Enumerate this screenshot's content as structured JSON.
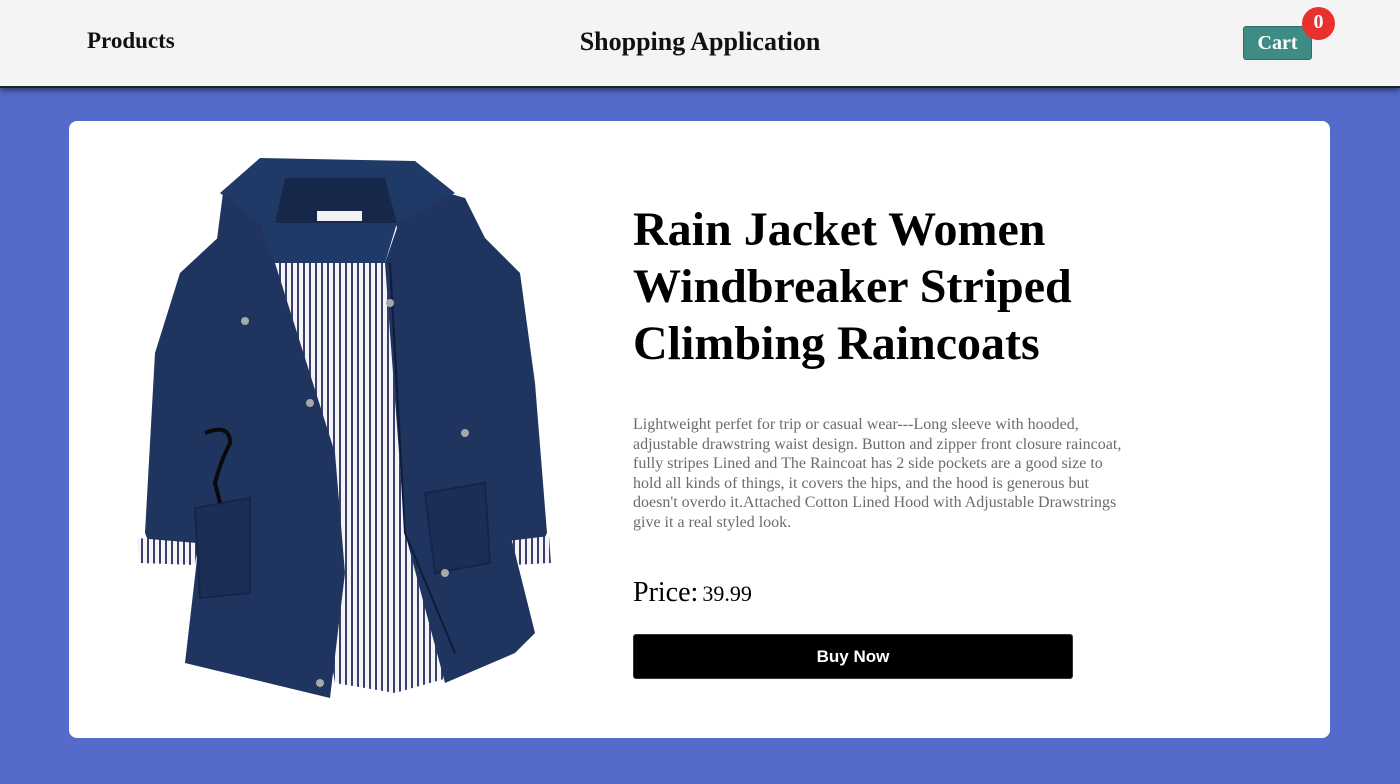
{
  "navbar": {
    "products_link": "Products",
    "app_title": "Shopping Application",
    "cart_label": "Cart",
    "cart_count": "0"
  },
  "product": {
    "title": "Rain Jacket Women Windbreaker Striped Climbing Raincoats",
    "description": "Lightweight perfet for trip or casual wear---Long sleeve with hooded, adjustable drawstring waist design. Button and zipper front closure raincoat, fully stripes Lined and The Raincoat has 2 side pockets are a good size to hold all kinds of things, it covers the hips, and the hood is generous but doesn't overdo it.Attached Cotton Lined Hood with Adjustable Drawstrings give it a real styled look.",
    "price_label": "Price:",
    "price_value": "39.99",
    "buy_button": "Buy Now",
    "image_subject": "navy rain jacket with striped lining"
  },
  "colors": {
    "page_background": "#546bcb",
    "navbar_background": "#f4f4f4",
    "cart_button": "#3f8c87",
    "cart_badge": "#e8302c",
    "buy_button": "#000000",
    "jacket": "#1f3560"
  }
}
